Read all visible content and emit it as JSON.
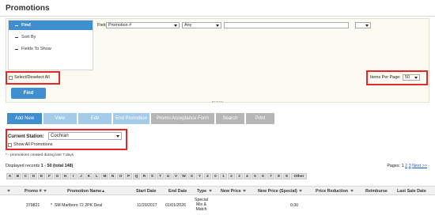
{
  "page": {
    "title": "Promotions"
  },
  "search_panel": {
    "nav": [
      {
        "label": "Find"
      },
      {
        "label": "Sort By"
      },
      {
        "label": "Fields To Show"
      }
    ],
    "field_label": "Field:",
    "field_select": "Promotion #",
    "operator_select": "Any",
    "value_input": "",
    "extra_select": "",
    "select_all_label": "Select/Deselect All",
    "items_per_page_label": "Items Per Page:",
    "items_per_page_value": "50",
    "find_button": "Find"
  },
  "toolbar": {
    "buttons": [
      "Add New",
      "View",
      "Edit",
      "End Promotion",
      "Promo Acceptance Form",
      "Search",
      "Print"
    ]
  },
  "station": {
    "label": "Current Station:",
    "value": "Cochran",
    "show_all_label": "Show All Promotions"
  },
  "note": "* - promotions created during last 7 days",
  "displayed": {
    "prefix": "Displayed records ",
    "range": "1 - 50 (total 148)"
  },
  "pagination": {
    "label": "Pages:",
    "pages": [
      "1",
      "2",
      "3"
    ],
    "next": "Next >>"
  },
  "alphabet": [
    "A",
    "B",
    "C",
    "D",
    "E",
    "F",
    "G",
    "H",
    "I",
    "J",
    "K",
    "L",
    "M",
    "N",
    "O",
    "P",
    "Q",
    "R",
    "S",
    "T",
    "U",
    "V",
    "W",
    "X",
    "Y",
    "Z",
    "0",
    "1",
    "2",
    "3",
    "4",
    "5",
    "6",
    "7",
    "8",
    "9",
    "Other"
  ],
  "table": {
    "columns": [
      "Promo #",
      "Promotion Name",
      "Start Date",
      "End Date",
      "Type",
      "New Price",
      "New Price (Special)",
      "Price Reduction",
      "Reimburse",
      "Last Sale Date"
    ],
    "rows": [
      {
        "promo": "379821",
        "name": "* .SM Marlboro 72 2PK Deal",
        "start": "11/20/2017",
        "end": "01/01/2026",
        "type_lines": [
          "Special",
          "Mix &",
          "Match"
        ],
        "new_price_special": "0.00"
      }
    ]
  },
  "colors": {
    "accent": "#3e8ed0",
    "highlight": "#e6262b",
    "disabled": "#a4cbea"
  }
}
